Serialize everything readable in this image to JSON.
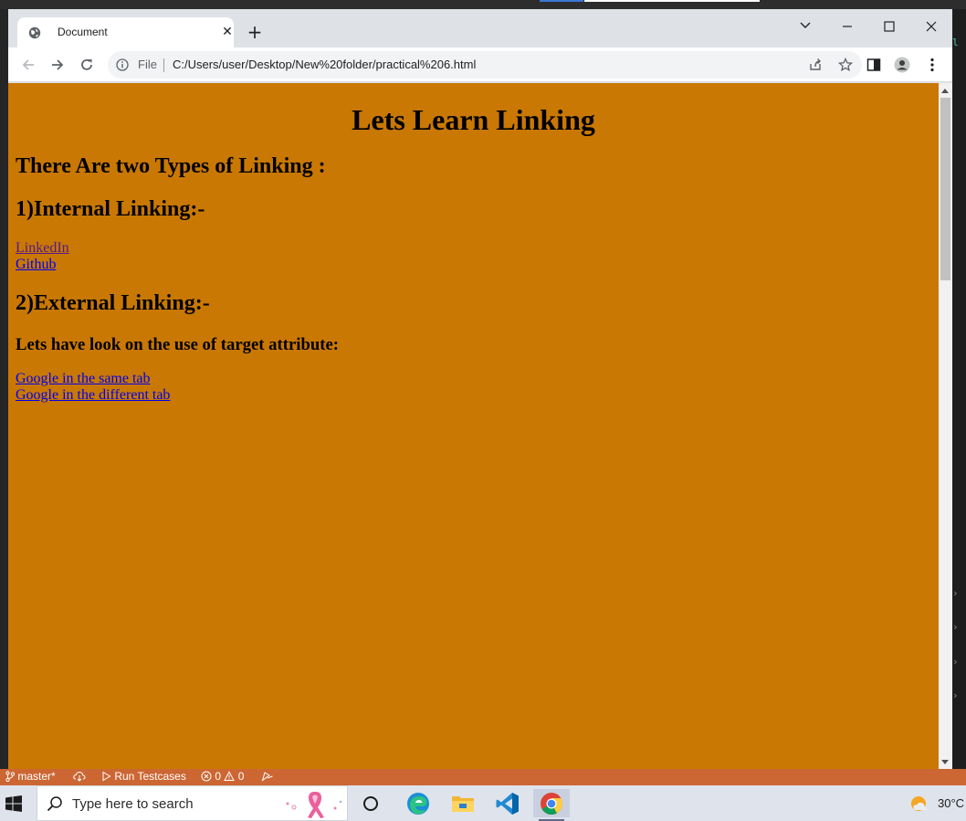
{
  "browser": {
    "tab_title": "Document",
    "address_scheme_label": "File",
    "address_url": "C:/Users/user/Desktop/New%20folder/practical%206.html",
    "page_background": "#c97803"
  },
  "page": {
    "heading": "Lets Learn Linking",
    "subheading": "There Are two Types of Linking :",
    "internal_heading": "1)Internal Linking:-",
    "internal_links": [
      "LinkedIn",
      "Github"
    ],
    "external_heading": "2)External Linking:-",
    "target_note": "Lets have look on the use of target attribute:",
    "external_links": [
      "Google in the same tab",
      "Google in the different tab"
    ],
    "visited_link_color": "#551a8b",
    "link_color": "#0000ee"
  },
  "statusbar": {
    "branch": "master*",
    "run_label": "Run Testcases",
    "errors": "0",
    "warnings": "0",
    "background": "#cc6633"
  },
  "taskbar": {
    "search_placeholder": "Type here to search",
    "temperature": "30°C"
  }
}
